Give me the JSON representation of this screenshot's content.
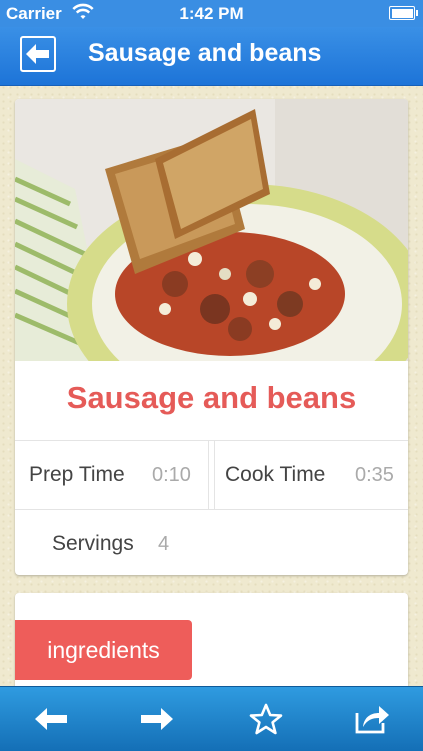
{
  "status_bar": {
    "carrier": "Carrier",
    "time": "1:42 PM"
  },
  "nav": {
    "title": "Sausage and beans",
    "back_icon": "back-arrow-icon"
  },
  "recipe": {
    "title": "Sausage and beans",
    "prep_time_label": "Prep Time",
    "prep_time_value": "0:10",
    "cook_time_label": "Cook Time",
    "cook_time_value": "0:35",
    "servings_label": "Servings",
    "servings_value": "4"
  },
  "ingredients": {
    "tab_label": "ingredients"
  },
  "toolbar": {
    "items": [
      "previous-arrow-icon",
      "next-arrow-icon",
      "star-icon",
      "share-icon"
    ]
  },
  "colors": {
    "nav_blue": "#1d74d8",
    "accent_red": "#e55b58",
    "tab_red": "#ee5d5a"
  }
}
